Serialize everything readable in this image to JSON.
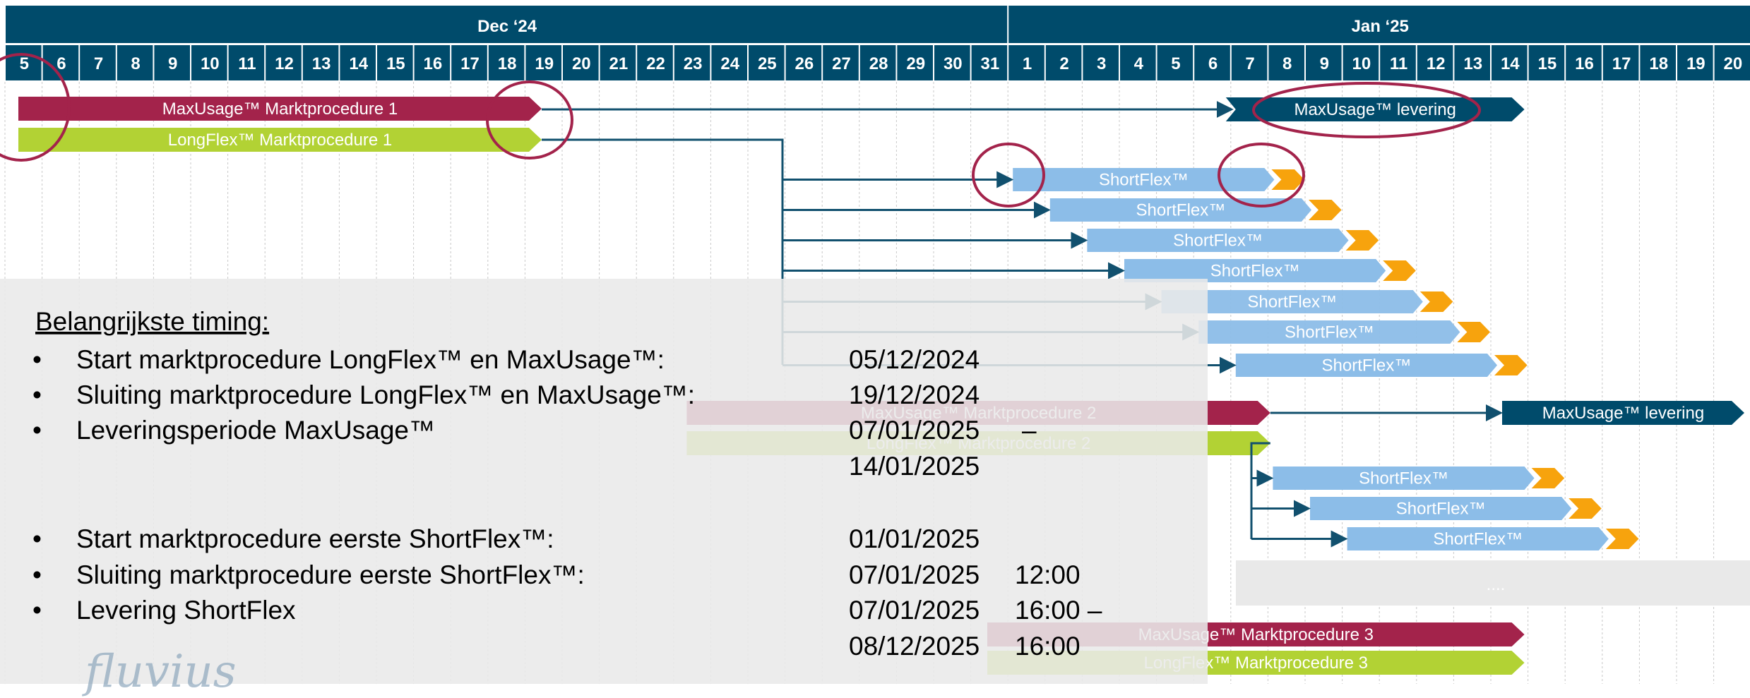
{
  "gantt": {
    "months": [
      {
        "label": "Dec ‘24",
        "first_day": 5,
        "days": 27
      },
      {
        "label": "Jan ‘25",
        "first_day": 1,
        "days": 20
      }
    ],
    "colors": {
      "header": "#004b6b",
      "maroon": "#a3234b",
      "lime": "#b2d234",
      "light_blue": "#8cbde8",
      "orange": "#f7a30d",
      "arrow": "#11506e",
      "circle": "#a3234b",
      "overlay": "#e9e9e9"
    },
    "tasks": [
      {
        "id": "t1",
        "label": "MaxUsage™ Marktprocedure 1",
        "color": "maroon",
        "start": "2024-12-05",
        "end": "2024-12-19"
      },
      {
        "id": "t2",
        "label": "LongFlex™ Marktprocedure 1",
        "color": "lime",
        "start": "2024-12-05",
        "end": "2024-12-19"
      },
      {
        "id": "t3",
        "label": "MaxUsage™ levering",
        "color": "header",
        "start": "2025-01-07",
        "end": "2025-01-14"
      },
      {
        "id": "s1",
        "label": "ShortFlex™",
        "color": "light_blue",
        "start": "2025-01-01",
        "end": "2025-01-07",
        "tail": "2025-01-08"
      },
      {
        "id": "s2",
        "label": "ShortFlex™",
        "color": "light_blue",
        "start": "2025-01-02",
        "end": "2025-01-08",
        "tail": "2025-01-09"
      },
      {
        "id": "s3",
        "label": "ShortFlex™",
        "color": "light_blue",
        "start": "2025-01-03",
        "end": "2025-01-09",
        "tail": "2025-01-10"
      },
      {
        "id": "s4",
        "label": "ShortFlex™",
        "color": "light_blue",
        "start": "2025-01-04",
        "end": "2025-01-10",
        "tail": "2025-01-11"
      },
      {
        "id": "s5",
        "label": "ShortFlex™",
        "color": "light_blue",
        "start": "2025-01-05",
        "end": "2025-01-11",
        "tail": "2025-01-12"
      },
      {
        "id": "s6",
        "label": "ShortFlex™",
        "color": "light_blue",
        "start": "2025-01-06",
        "end": "2025-01-12",
        "tail": "2025-01-13"
      },
      {
        "id": "s7",
        "label": "ShortFlex™",
        "color": "light_blue",
        "start": "2025-01-07",
        "end": "2025-01-13",
        "tail": "2025-01-14"
      },
      {
        "id": "m2",
        "label": "MaxUsage™ Marktprocedure 2",
        "color": "maroon",
        "start": "2024-12-24",
        "end": "2025-01-06"
      },
      {
        "id": "l2",
        "label": "LongFlex™ Marktprocedure 2",
        "color": "lime",
        "start": "2024-12-24",
        "end": "2025-01-06"
      },
      {
        "id": "t4",
        "label": "MaxUsage™ levering",
        "color": "header",
        "start": "2025-01-14",
        "end": "2025-01-20"
      },
      {
        "id": "s8",
        "label": "ShortFlex™",
        "color": "light_blue",
        "start": "2025-01-08",
        "end": "2025-01-14",
        "tail": "2025-01-15"
      },
      {
        "id": "s9",
        "label": "ShortFlex™",
        "color": "light_blue",
        "start": "2025-01-09",
        "end": "2025-01-15",
        "tail": "2025-01-16"
      },
      {
        "id": "s10",
        "label": "ShortFlex™",
        "color": "light_blue",
        "start": "2025-01-10",
        "end": "2025-01-16",
        "tail": "2025-01-17"
      },
      {
        "id": "m3",
        "label": "MaxUsage™ Marktprocedure 3",
        "color": "maroon",
        "start": "2024-12-31",
        "end": "2025-01-14"
      },
      {
        "id": "l3",
        "label": "LongFlex™ Marktprocedure 3",
        "color": "lime",
        "start": "2024-12-31",
        "end": "2025-01-14"
      }
    ],
    "ellipsis_text": "....",
    "timing": {
      "heading": "Belangrijkste timing:",
      "bullet": "•",
      "items": [
        {
          "label": "Start marktprocedure LongFlex™ en MaxUsage™:",
          "date": "05/12/2024",
          "time": ""
        },
        {
          "label": "Sluiting marktprocedure LongFlex™ en MaxUsage™:",
          "date": "19/12/2024",
          "time": ""
        },
        {
          "label": "Leveringsperiode MaxUsage™",
          "date": "07/01/2025",
          "time": "–",
          "date2": "14/01/2025"
        },
        {
          "label": "Start marktprocedure eerste ShortFlex™:",
          "date": "01/01/2025",
          "time": ""
        },
        {
          "label": "Sluiting marktprocedure eerste ShortFlex™:",
          "date": "07/01/2025",
          "time": "12:00"
        },
        {
          "label": "Levering ShortFlex",
          "date": "07/01/2025",
          "time": "16:00 –",
          "date2": "08/12/2025",
          "time2": "16:00"
        }
      ]
    }
  },
  "logo_text": "fluvius"
}
